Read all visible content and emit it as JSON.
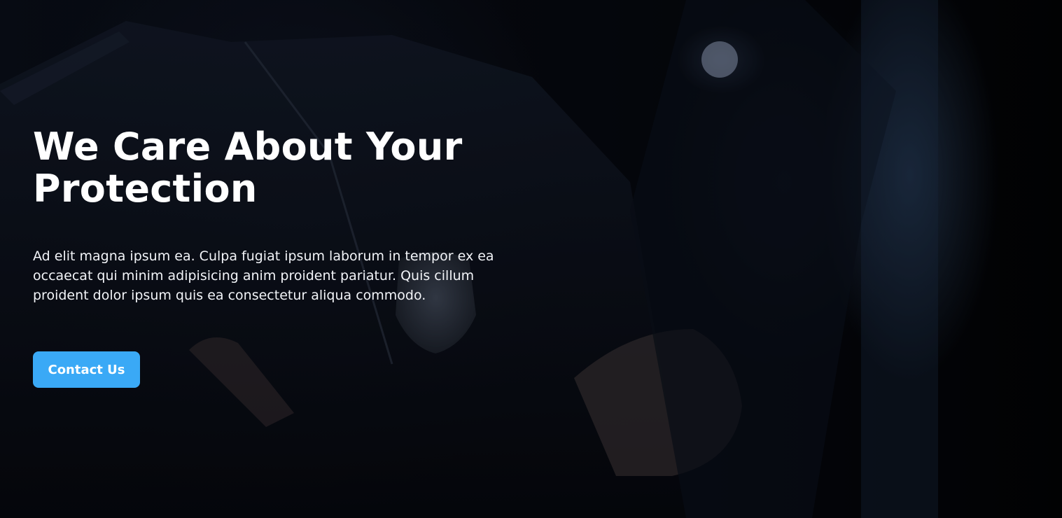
{
  "hero": {
    "headline_line1": "We Care About Your",
    "headline_line2": "Protection",
    "description": "Ad elit magna ipsum ea. Culpa fugiat ipsum laborum in tempor ex ea occaecat qui minim adipisicing anim proident pariatur. Quis cillum proident dolor ipsum quis ea consectetur aliqua commodo.",
    "cta_label": "Contact Us",
    "background_image": "police-officer-photo"
  },
  "colors": {
    "accent": "#3aa9f6",
    "text": "#ffffff",
    "background": "#05070d"
  }
}
